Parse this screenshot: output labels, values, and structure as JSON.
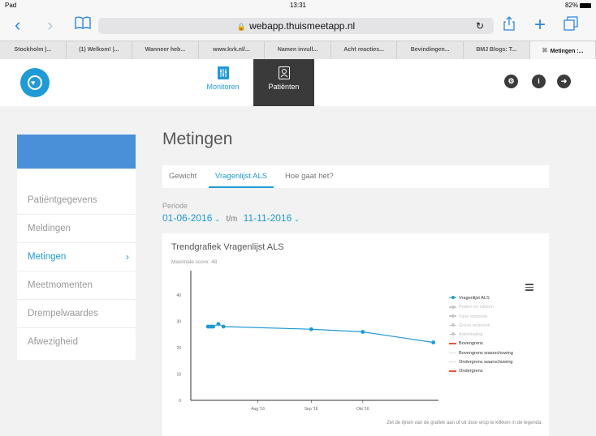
{
  "status": {
    "device": "Pad",
    "time": "13:31",
    "battery": "82%"
  },
  "browser": {
    "url": "webapp.thuismeetapp.nl",
    "tabs": [
      "Stockholm |...",
      "(1) Welkom! |...",
      "Wanneer heb...",
      "www.kvk.nl/...",
      "Namen invull...",
      "Acht reacties...",
      "Bevindingen...",
      "BMJ Blogs: T...",
      "Metingen :..."
    ],
    "active_tab": 8
  },
  "app": {
    "nav": {
      "monitoren": "Monitoren",
      "patienten": "Patiënten"
    },
    "icons": {
      "settings": "gear-icon",
      "info": "info-icon",
      "logout": "logout-icon"
    },
    "brand_color": "#1f9ad6"
  },
  "sidebar": {
    "items": [
      {
        "label": "Patiëntgegevens"
      },
      {
        "label": "Meldingen"
      },
      {
        "label": "Metingen"
      },
      {
        "label": "Meetmomenten"
      },
      {
        "label": "Drempelwaardes"
      },
      {
        "label": "Afwezigheid"
      }
    ],
    "active": "Metingen"
  },
  "main": {
    "title": "Metingen",
    "tabs": [
      {
        "label": "Gewicht"
      },
      {
        "label": "Vragenlijst ALS"
      },
      {
        "label": "Hoe gaat het?"
      }
    ],
    "active_tab": "Vragenlijst ALS",
    "period": {
      "label": "Periode",
      "from": "01-06-2016",
      "to_sep": "t/m",
      "to": "11-11-2016"
    }
  },
  "chart_card": {
    "title": "Trendgrafiek Vragenlijst ALS",
    "subtitle": "Maximale score: 48",
    "footnote": "Zet de lijnen van de grafiek aan of uit door erop te klikken in de legenda."
  },
  "chart_data": {
    "type": "line",
    "title": "Trendgrafiek Vragenlijst ALS",
    "xlabel": "",
    "ylabel": "",
    "x_ticks": [
      "Aug '16",
      "Sep '16",
      "Okt '16"
    ],
    "y_ticks": [
      0,
      10,
      20,
      30,
      40
    ],
    "ylim": [
      0,
      48
    ],
    "series": [
      {
        "name": "Vragenlijst ALS",
        "color": "#1f9ad6",
        "x": [
          "2016-07-03",
          "2016-07-04",
          "2016-07-05",
          "2016-07-06",
          "2016-07-09",
          "2016-07-12",
          "2016-09-01",
          "2016-10-01",
          "2016-11-11"
        ],
        "values": [
          28,
          28,
          28,
          28,
          29,
          28,
          27,
          26,
          22
        ]
      }
    ],
    "legend": [
      {
        "name": "Vragenlijst ALS",
        "color": "#1f9ad6",
        "marker": true,
        "visible": true
      },
      {
        "name": "Praten en slikken",
        "color": "#c8c8c8",
        "marker": true,
        "visible": false
      },
      {
        "name": "Fijne motoriek",
        "color": "#c8c8c8",
        "marker": true,
        "visible": false
      },
      {
        "name": "Grove motoriek",
        "color": "#c8c8c8",
        "marker": true,
        "visible": false
      },
      {
        "name": "Ademhaling",
        "color": "#c8c8c8",
        "marker": true,
        "visible": false
      },
      {
        "name": "Bovengrens",
        "color": "#e8553b",
        "marker": false,
        "visible": true
      },
      {
        "name": "Bovengrens waarschuwing",
        "color": "#dddddd",
        "marker": false,
        "visible": true
      },
      {
        "name": "Ondergrens waarschuwing",
        "color": "#dddddd",
        "marker": false,
        "visible": true
      },
      {
        "name": "Ondergrens",
        "color": "#e8553b",
        "marker": false,
        "visible": true
      }
    ],
    "legend_position": "right",
    "grid": false
  }
}
